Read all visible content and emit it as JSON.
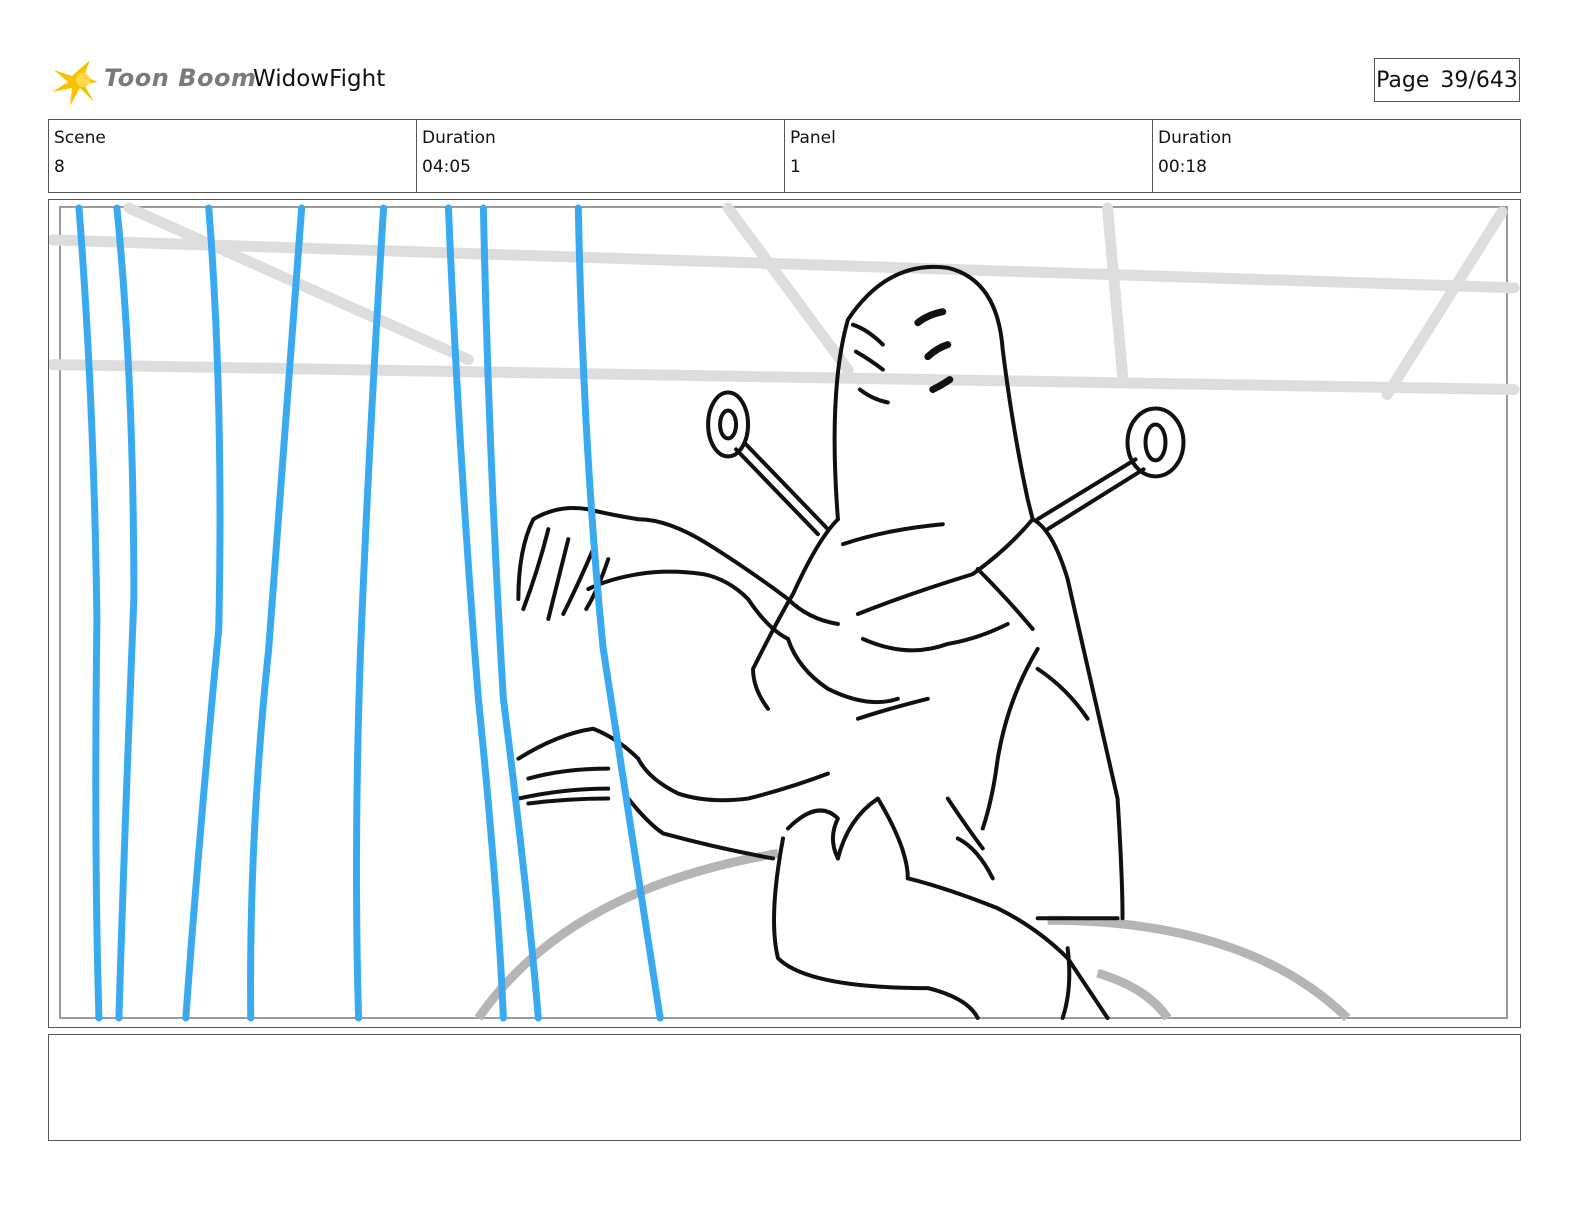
{
  "header": {
    "logo_text": "Toon Boom",
    "project_title": "WidowFight",
    "page_label": "Page",
    "page_number": "39/643"
  },
  "info": {
    "scene_label": "Scene",
    "scene_value": "8",
    "scene_duration_label": "Duration",
    "scene_duration_value": "04:05",
    "panel_label": "Panel",
    "panel_value": "1",
    "panel_duration_label": "Duration",
    "panel_duration_value": "00:18"
  },
  "notes": {
    "text": ""
  },
  "colors": {
    "rain_blue": "#3aaaf0",
    "sketch_black": "#111111",
    "background_gray": "#d8d8d8",
    "logo_yellow": "#f5c400"
  }
}
